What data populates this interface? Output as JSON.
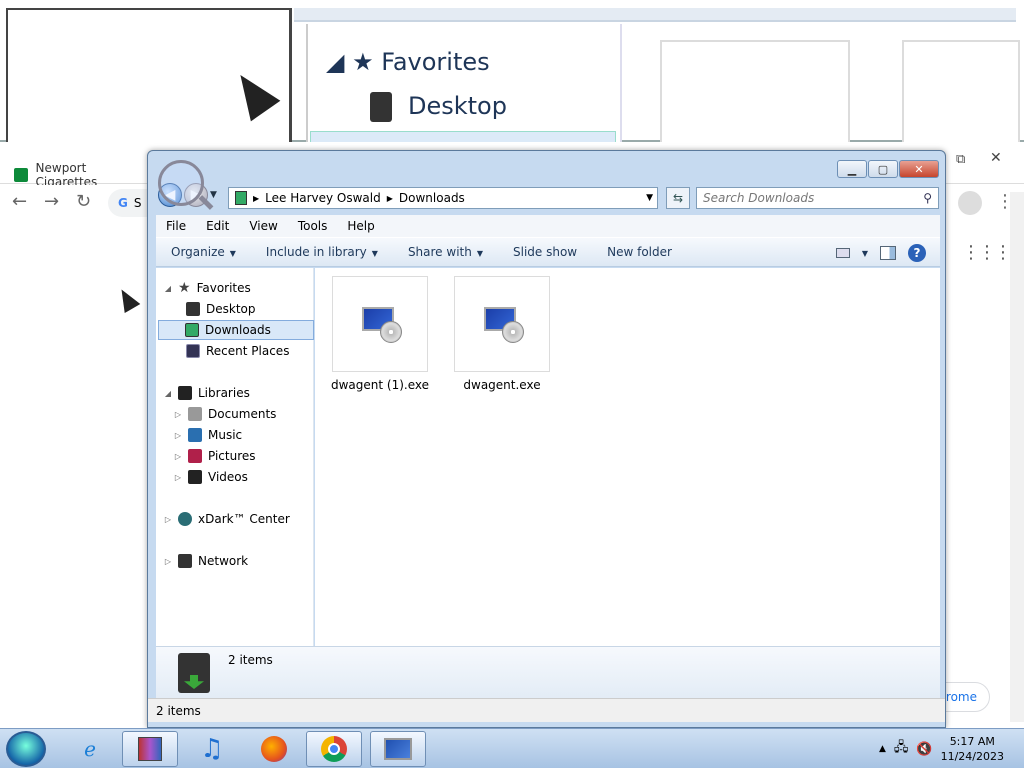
{
  "zoom_overlay": {
    "favorites_label": "Favorites",
    "desktop_label": "Desktop"
  },
  "browser": {
    "tab_title": "Newport Cigarettes",
    "omnibox_letter": "S",
    "right_pill_text": "rome"
  },
  "explorer": {
    "breadcrumb": [
      "Lee Harvey Oswald",
      "Downloads"
    ],
    "search_placeholder": "Search Downloads",
    "menu": [
      "File",
      "Edit",
      "View",
      "Tools",
      "Help"
    ],
    "commands": {
      "organize": "Organize",
      "include_in_library": "Include in library",
      "share_with": "Share with",
      "slide_show": "Slide show",
      "new_folder": "New folder"
    },
    "nav": {
      "favorites": "Favorites",
      "desktop": "Desktop",
      "downloads": "Downloads",
      "recent_places": "Recent Places",
      "libraries": "Libraries",
      "documents": "Documents",
      "music": "Music",
      "pictures": "Pictures",
      "videos": "Videos",
      "xdark_center": "xDark™ Center",
      "network": "Network"
    },
    "files": [
      {
        "name": "dwagent (1).exe"
      },
      {
        "name": "dwagent.exe"
      }
    ],
    "details_count": "2 items",
    "status_count": "2 items"
  },
  "taskbar": {
    "clock_time": "5:17 AM",
    "clock_date": "11/24/2023"
  }
}
